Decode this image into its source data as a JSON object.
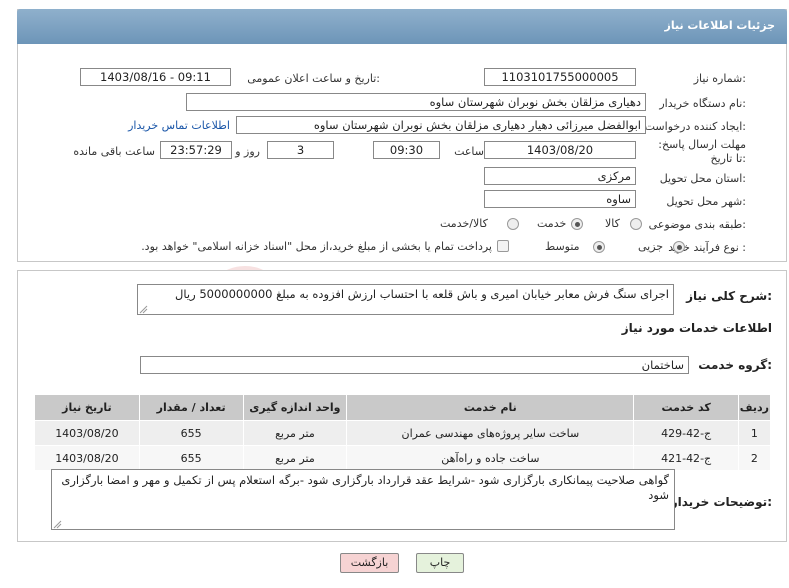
{
  "header": {
    "title": "جزئیات اطلاعات نیاز"
  },
  "form": {
    "need_number_label": "شماره نیاز:",
    "need_number": "1103101755000005",
    "announce_label": "تاریخ و ساعت اعلان عمومی:",
    "announce_value": "1403/08/16 - 09:11",
    "buyer_org_label": "نام دستگاه خریدار:",
    "buyer_org": "دهیاری مزلقان بخش نوبران شهرستان ساوه",
    "creator_label": "ایجاد کننده درخواست:",
    "creator": "ابوالفضل میرزائی دهیار دهیاری مزلقان بخش نوبران شهرستان ساوه",
    "contact_link": "اطلاعات تماس خریدار",
    "deadline_label": "مهلت ارسال پاسخ: تا تاریخ:",
    "deadline_date": "1403/08/20",
    "time_label": "ساعت",
    "deadline_time": "09:30",
    "days": "3",
    "days_label": "روز و",
    "remaining_time": "23:57:29",
    "remaining_label": "ساعت باقی مانده",
    "province_label": "استان محل تحویل:",
    "province": "مرکزی",
    "city_label": "شهر محل تحویل:",
    "city": "ساوه",
    "category_label": "طبقه بندی موضوعی:",
    "category_options": [
      "کالا",
      "خدمت",
      "کالا/خدمت"
    ],
    "category_selected": "خدمت",
    "process_label": "نوع فرآیند خرید :",
    "process_options": [
      "جزیی",
      "متوسط"
    ],
    "process_selected": "جزیی",
    "payment_note": "پرداخت تمام یا بخشی از مبلغ خرید،از محل \"اسناد خزانه اسلامی\" خواهد بود."
  },
  "summary": {
    "label": "شرح کلی نیاز:",
    "text": "اجرای سنگ فرش معابر خیابان امیری و باش قلعه با احتساب ارزش افزوده به مبلغ 5000000000 ریال"
  },
  "services": {
    "section_title": "اطلاعات خدمات مورد نیاز",
    "group_label": "گروه خدمت:",
    "group_value": "ساختمان",
    "columns": [
      "ردیف",
      "کد خدمت",
      "نام خدمت",
      "واحد اندازه گیری",
      "تعداد / مقدار",
      "تاریخ نیاز"
    ],
    "rows": [
      [
        "1",
        "ج-42-429",
        "ساخت سایر پروژه‌های مهندسی عمران",
        "متر مربع",
        "655",
        "1403/08/20"
      ],
      [
        "2",
        "ج-42-421",
        "ساخت جاده و راه‌آهن",
        "متر مربع",
        "655",
        "1403/08/20"
      ]
    ]
  },
  "buyer_notes": {
    "label": "توضیحات خریدار:",
    "text": "گواهی صلاحیت پیمانکاری بارگزاری شود -شرایط عقد قرارداد بارگزاری شود -برگه استعلام پس از تکمیل و مهر و امضا بارگزاری شود"
  },
  "buttons": {
    "print": "چاپ",
    "back": "بازگشت"
  },
  "watermark": {
    "text": "AriaTender.neT"
  },
  "colors": {
    "header": "#7fa3c4",
    "link": "#1a56a8",
    "back_button": "#f6d3d3",
    "print_button": "#e5f2dc"
  },
  "icons": {
    "watermark": "aria-tender-logo-icon",
    "resize": "resize-grip-icon"
  }
}
